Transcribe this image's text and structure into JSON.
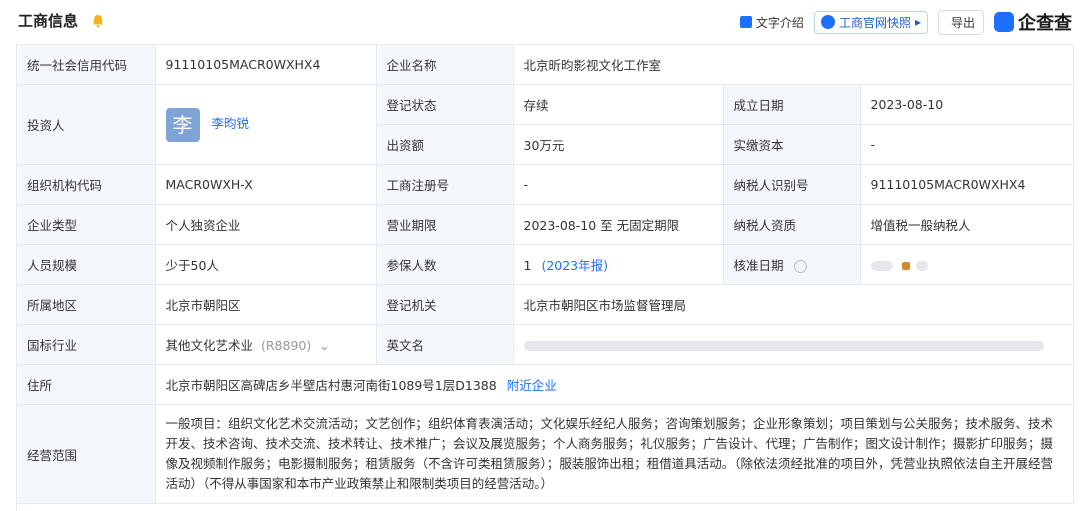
{
  "header": {
    "title": "工商信息",
    "text_intro": "文字介绍",
    "snapshot": "工商官网快照",
    "snapshot_arrow": "▸",
    "export": "导出",
    "brand": "企查查"
  },
  "rows": {
    "credit_code_label": "统一社会信用代码",
    "credit_code_value": "91110105MACR0WXHX4",
    "company_name_label": "企业名称",
    "company_name_value": "北京昕昀影视文化工作室",
    "investor_label": "投资人",
    "investor_avatar": "李",
    "investor_name": "李昀锐",
    "reg_status_label": "登记状态",
    "reg_status_value": "存续",
    "found_date_label": "成立日期",
    "found_date_value": "2023-08-10",
    "capital_label": "出资额",
    "capital_value": "30万元",
    "paid_capital_label": "实缴资本",
    "paid_capital_value": "-",
    "org_code_label": "组织机构代码",
    "org_code_value": "MACR0WXH-X",
    "biz_reg_label": "工商注册号",
    "biz_reg_value": "-",
    "tax_id_label": "纳税人识别号",
    "tax_id_value": "91110105MACR0WXHX4",
    "company_type_label": "企业类型",
    "company_type_value": "个人独资企业",
    "term_label": "营业期限",
    "term_value": "2023-08-10 至 无固定期限",
    "taxpayer_qual_label": "纳税人资质",
    "taxpayer_qual_value": "增值税一般纳税人",
    "staff_label": "人员规模",
    "staff_value": "少于50人",
    "insured_label": "参保人数",
    "insured_value": "1",
    "insured_year": "(2023年报)",
    "approval_label": "核准日期",
    "region_label": "所属地区",
    "region_value": "北京市朝阳区",
    "authority_label": "登记机关",
    "authority_value": "北京市朝阳区市场监督管理局",
    "industry_label": "国标行业",
    "industry_value": "其他文化艺术业",
    "industry_code": "(R8890)",
    "english_label": "英文名",
    "address_label": "住所",
    "address_value": "北京市朝阳区高碑店乡半壁店村惠河南街1089号1层D1388",
    "nearby": "附近企业",
    "scope_label": "经营范围",
    "scope_value": "一般项目：组织文化艺术交流活动；文艺创作；组织体育表演活动；文化娱乐经纪人服务；咨询策划服务；企业形象策划；项目策划与公关服务；技术服务、技术开发、技术咨询、技术交流、技术转让、技术推广；会议及展览服务；个人商务服务；礼仪服务；广告设计、代理；广告制作；图文设计制作；摄影扩印服务；摄像及视频制作服务；电影摄制服务；租赁服务（不含许可类租赁服务）；服装服饰出租；租借道具活动。（除依法须经批准的项目外，凭营业执照依法自主开展经营活动）（不得从事国家和本市产业政策禁止和限制类项目的经营活动。）"
  }
}
